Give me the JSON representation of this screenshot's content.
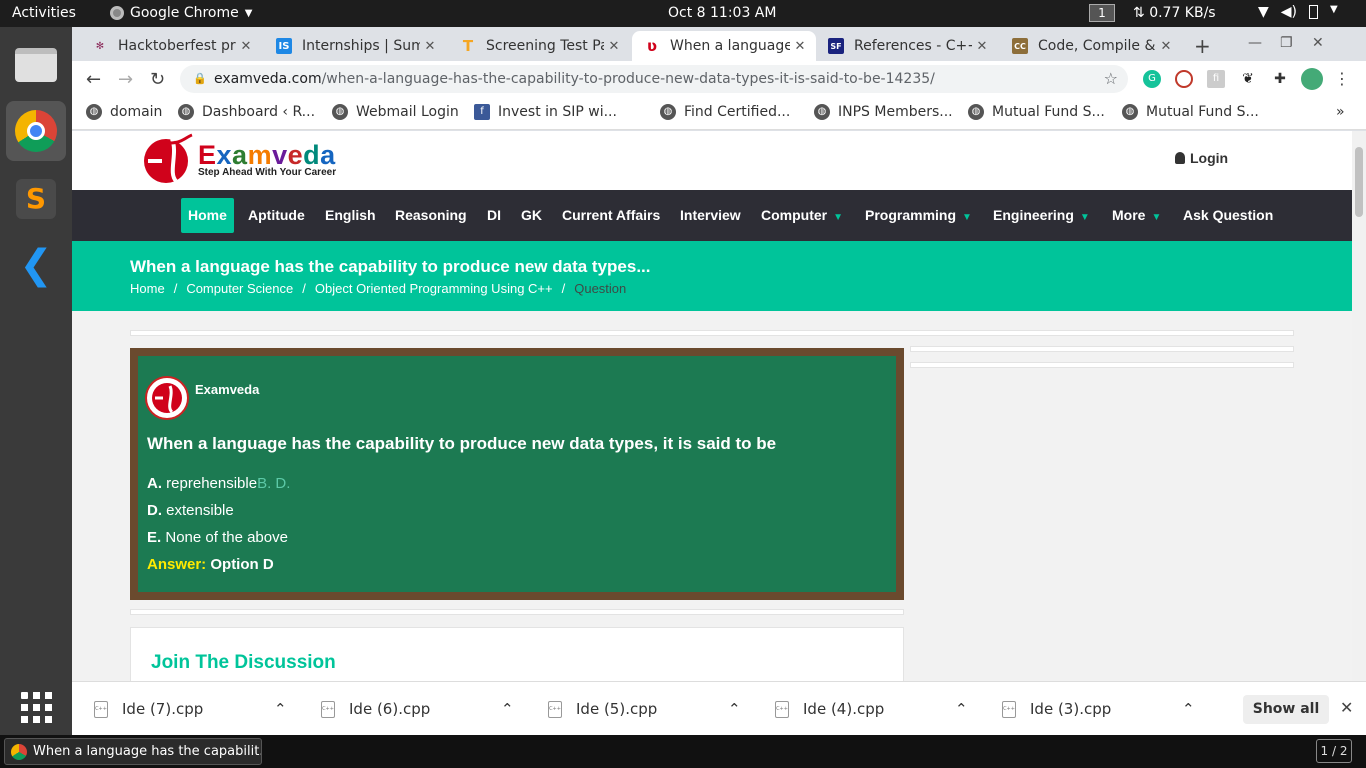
{
  "system": {
    "activities": "Activities",
    "app_name": "Google Chrome",
    "clock": "Oct 8  11:03 AM",
    "workspace": "1",
    "net_speed": "0.77 KB/s"
  },
  "browser": {
    "tabs": [
      {
        "title": "Hacktoberfest pr",
        "favicon": "hacktoberfest-icon",
        "color": "#8b2a5a"
      },
      {
        "title": "Internships | Sum",
        "favicon": "internshala-icon",
        "color": "#1e88e5"
      },
      {
        "title": "Screening Test Pa",
        "favicon": "testpad-icon",
        "color": "#f5a623"
      },
      {
        "title": "When a language",
        "favicon": "examveda-icon",
        "color": "#d0021b"
      },
      {
        "title": "References - C++ I",
        "favicon": "sf-icon",
        "color": "#1a237e"
      },
      {
        "title": "Code, Compile & R",
        "favicon": "cc-icon",
        "color": "#8d6e3a"
      }
    ],
    "url_domain": "examveda.com",
    "url_path": "/when-a-language-has-the-capability-to-produce-new-data-types-it-is-said-to-be-14235/",
    "bookmarks": [
      {
        "label": "domain"
      },
      {
        "label": "Dashboard ‹ R..."
      },
      {
        "label": "Webmail Login"
      },
      {
        "label": "Invest in SIP wi..."
      },
      {
        "label": "Find Certified..."
      },
      {
        "label": "INPS Members..."
      },
      {
        "label": "Mutual Fund S..."
      },
      {
        "label": "Mutual Fund S..."
      }
    ],
    "bookmarks_more": "»"
  },
  "site": {
    "logo_word": "Examveda",
    "logo_tagline": "Step Ahead With Your Career",
    "login": "Login",
    "nav": [
      {
        "label": "Home",
        "active": true,
        "dropdown": false
      },
      {
        "label": "Aptitude",
        "active": false,
        "dropdown": false
      },
      {
        "label": "English",
        "active": false,
        "dropdown": false
      },
      {
        "label": "Reasoning",
        "active": false,
        "dropdown": false
      },
      {
        "label": "DI",
        "active": false,
        "dropdown": false
      },
      {
        "label": "GK",
        "active": false,
        "dropdown": false
      },
      {
        "label": "Current Affairs",
        "active": false,
        "dropdown": false
      },
      {
        "label": "Interview",
        "active": false,
        "dropdown": false
      },
      {
        "label": "Computer",
        "active": false,
        "dropdown": true
      },
      {
        "label": "Programming",
        "active": false,
        "dropdown": true
      },
      {
        "label": "Engineering",
        "active": false,
        "dropdown": true
      },
      {
        "label": "More",
        "active": false,
        "dropdown": true
      },
      {
        "label": "Ask Question",
        "active": false,
        "dropdown": false
      }
    ],
    "banner_title": "When a language has the capability to produce new data types...",
    "breadcrumb": [
      "Home",
      "Computer Science",
      "Object Oriented Programming Using C++",
      "Question"
    ],
    "breadcrumb_sep": "/",
    "question": {
      "author": "Examveda",
      "text": "When a language has the capability to produce new data types, it is said to be",
      "options": [
        {
          "letter": "A.",
          "text": "reprehensible",
          "trail": "B. D."
        },
        {
          "letter": "D.",
          "text": "extensible",
          "trail": ""
        },
        {
          "letter": "E.",
          "text": "None of the above",
          "trail": ""
        }
      ],
      "answer_label": "Answer:",
      "answer_value": "Option D"
    },
    "discussion_title": "Join The Discussion"
  },
  "downloads": {
    "files": [
      "Ide (7).cpp",
      "Ide (6).cpp",
      "Ide (5).cpp",
      "Ide (4).cpp",
      "Ide (3).cpp"
    ],
    "show_all": "Show all"
  },
  "taskbar": {
    "window_title": "When a language has the capabilit...",
    "pager": "1 / 2"
  }
}
